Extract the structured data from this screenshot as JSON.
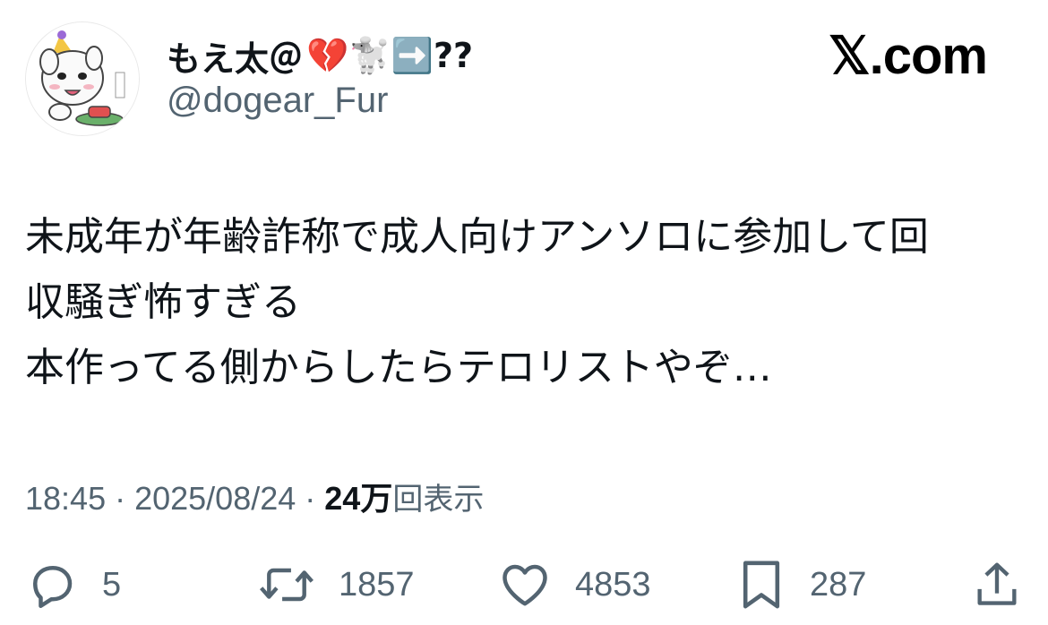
{
  "author": {
    "display_name": "もえ太＠",
    "emoji_suffix": "💔🐩➡️??",
    "handle": "@dogear_Fur",
    "avatar": "white-dog-avatar-icon"
  },
  "brand": {
    "logo_text": "𝕏.com"
  },
  "tweet": {
    "text": "未成年が年齢詐称で成人向けアンソロに参加して回\n収騒ぎ怖すぎる\n本作ってる側からしたらテロリストやぞ…",
    "time": "18:45",
    "separator_1": " · ",
    "date": "2025/08/24",
    "separator_2": " · ",
    "views_count": "24万",
    "views_label": "回表示"
  },
  "actions": {
    "reply": {
      "icon": "reply-icon",
      "count": "5"
    },
    "retweet": {
      "icon": "retweet-icon",
      "count": "1857"
    },
    "like": {
      "icon": "heart-icon",
      "count": "4853"
    },
    "bookmark": {
      "icon": "bookmark-icon",
      "count": "287"
    },
    "share": {
      "icon": "share-icon"
    }
  },
  "colors": {
    "text_primary": "#0f1419",
    "text_secondary": "#536471",
    "background": "#ffffff"
  }
}
